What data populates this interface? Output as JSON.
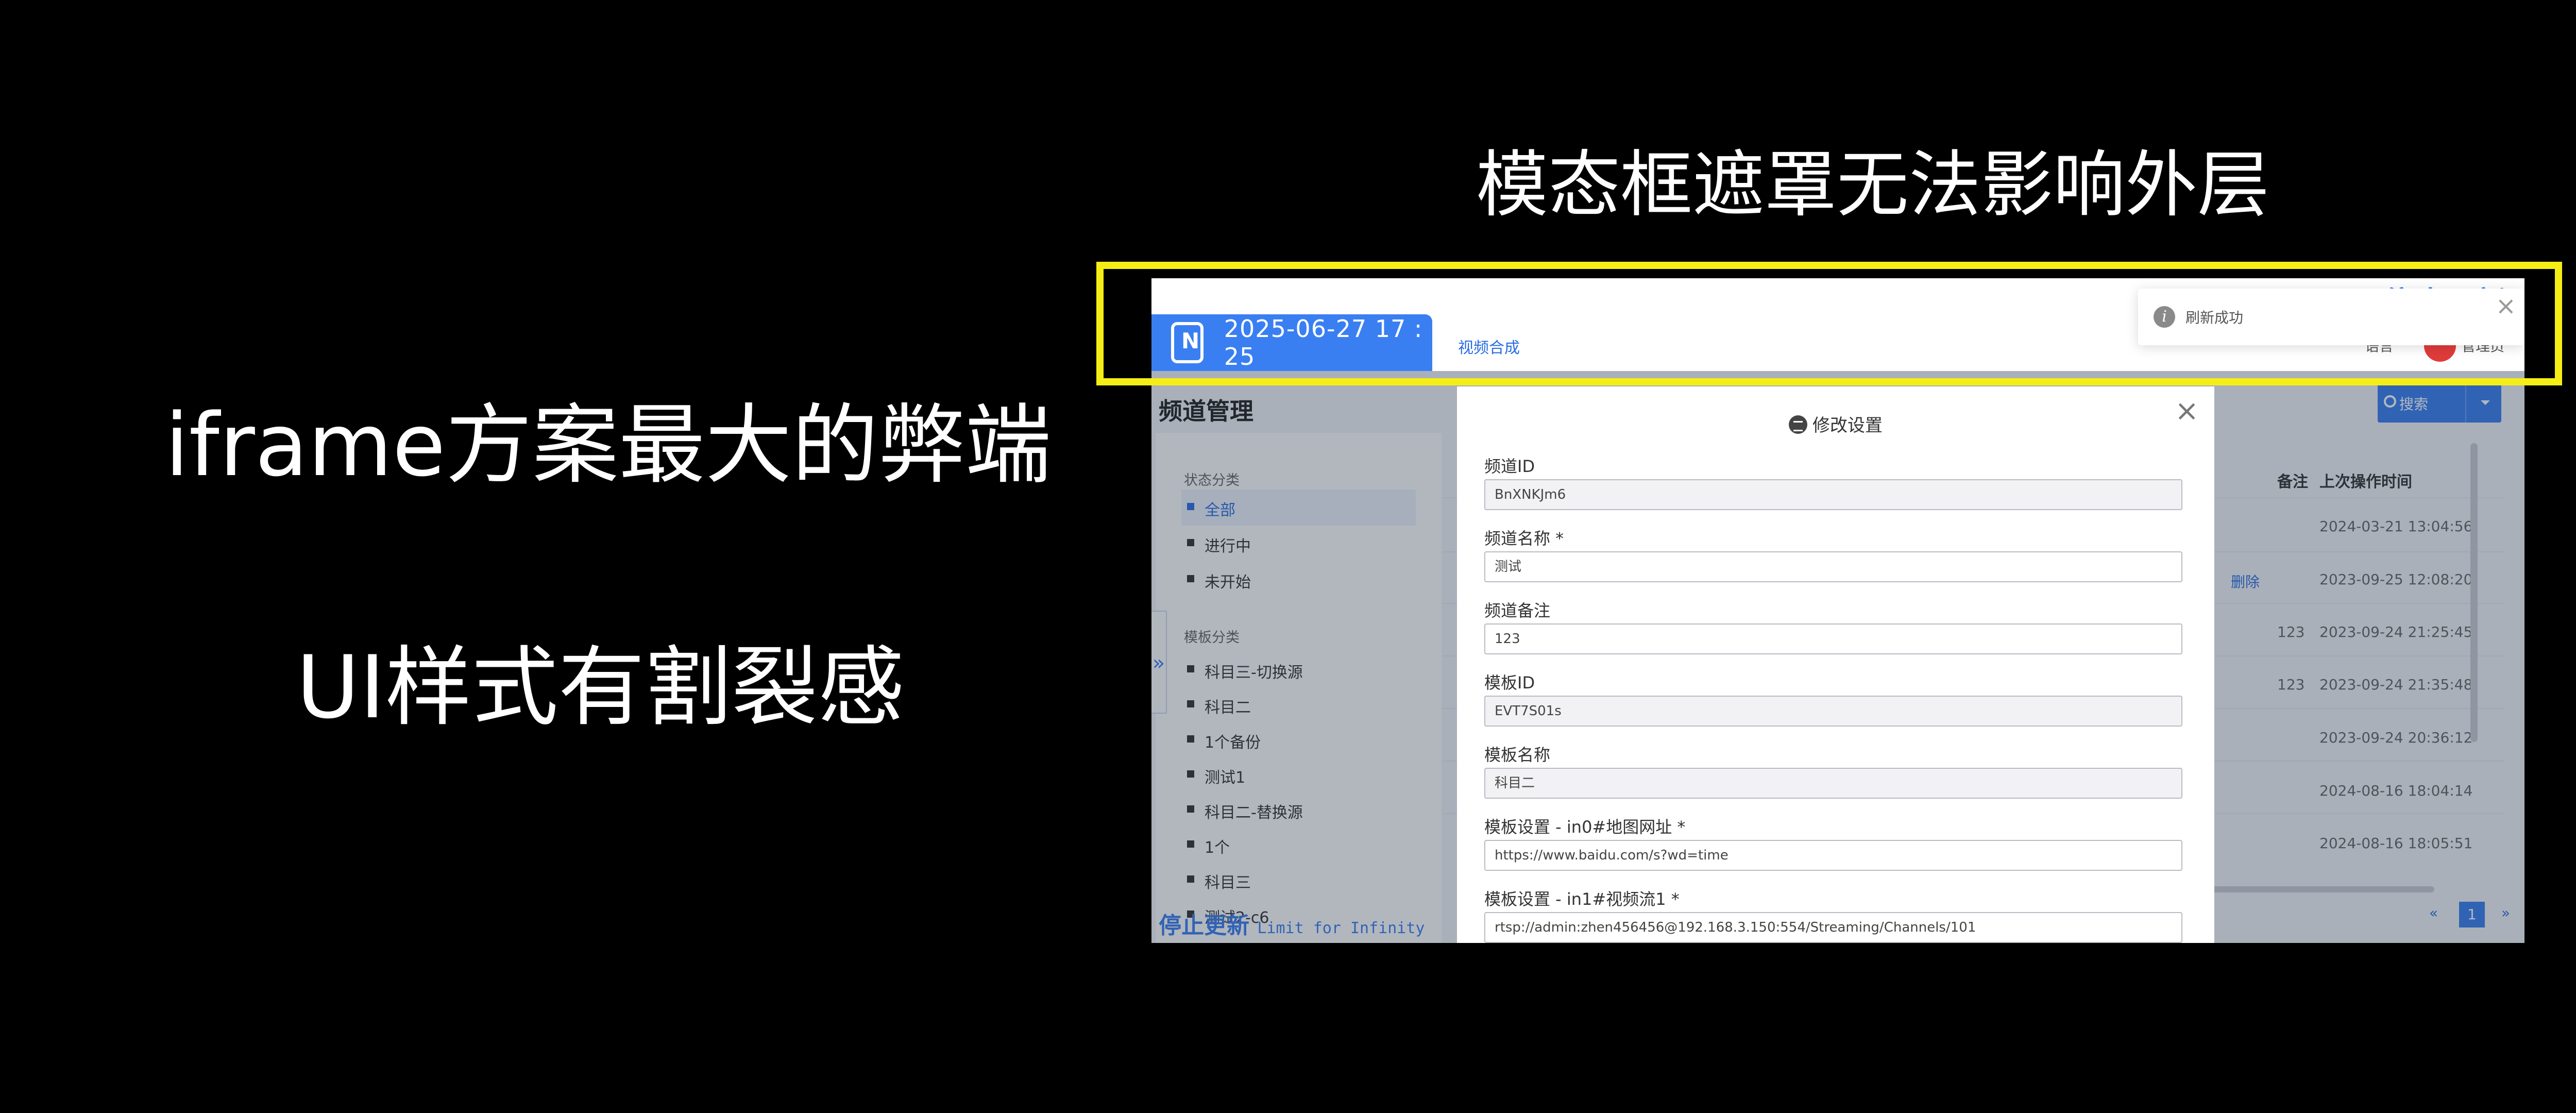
{
  "slide": {
    "left_title": "iframe方案最大的弊端",
    "left_subtitle": "UI样式有割裂感",
    "right_title": "模态框遮罩无法影响外层"
  },
  "colors": {
    "background": "#000000",
    "highlight": "#f5ee16",
    "accent": "#3a7ff2"
  },
  "app": {
    "header": {
      "datetime": "2025-06-27 17 : 25",
      "nav_link": "视频合成",
      "corner_brand": "停止更新",
      "right_text": "语言",
      "user": "管理员"
    },
    "toast": {
      "icon": "info-icon",
      "message": "刷新成功"
    },
    "page_title": "频道管理",
    "sidebar": {
      "status_group": "状态分类",
      "status_items": [
        "全部",
        "进行中",
        "未开始"
      ],
      "template_group": "模板分类",
      "template_items": [
        "科目三-切换源",
        "科目二",
        "1个备份",
        "测试1",
        "科目二-替换源",
        "1个",
        "科目三",
        "测试2-c6"
      ]
    },
    "bottom_brand": "停止更新",
    "bottom_brand_sub": "Limit for Infinity",
    "search_label": "搜索",
    "table": {
      "headers": [
        "备注",
        "上次操作时间"
      ],
      "delete_label": "删除",
      "rows": [
        {
          "note": "",
          "time": "2024-03-21 13:04:56"
        },
        {
          "note": "",
          "time": "2023-09-25 12:08:20"
        },
        {
          "note": "123",
          "time": "2023-09-24 21:25:45"
        },
        {
          "note": "123",
          "time": "2023-09-24 21:35:48"
        },
        {
          "note": "",
          "time": "2023-09-24 20:36:12"
        },
        {
          "note": "",
          "time": "2024-08-16 18:04:14"
        },
        {
          "note": "",
          "time": "2024-08-16 18:05:51"
        }
      ]
    },
    "pager": {
      "prev": "«",
      "current": "1",
      "next": "»"
    },
    "modal": {
      "title": "修改设置",
      "fields": [
        {
          "label": "频道ID",
          "value": "BnXNKJm6"
        },
        {
          "label": "频道名称 *",
          "value": "测试"
        },
        {
          "label": "频道备注",
          "value": "123"
        },
        {
          "label": "模板ID",
          "value": "EVT7S01s"
        },
        {
          "label": "模板名称",
          "value": "科目二"
        },
        {
          "label": "模板设置 - in0#地图网址 *",
          "value": "https://www.baidu.com/s?wd=time"
        },
        {
          "label": "模板设置 - in1#视频流1 *",
          "value": "rtsp://admin:zhen456456@192.168.3.150:554/Streaming/Channels/101"
        }
      ]
    }
  }
}
